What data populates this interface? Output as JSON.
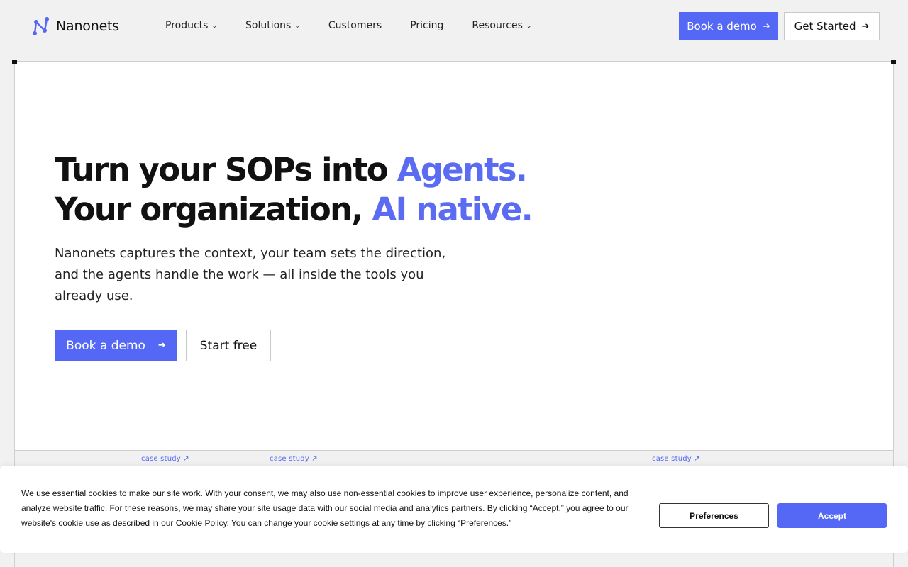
{
  "nav": {
    "logo_text": "Nanonets",
    "items": [
      {
        "label": "Products",
        "dropdown": true
      },
      {
        "label": "Solutions",
        "dropdown": true
      },
      {
        "label": "Customers",
        "dropdown": false
      },
      {
        "label": "Pricing",
        "dropdown": false
      },
      {
        "label": "Resources",
        "dropdown": true
      }
    ],
    "book_demo": "Book a demo",
    "get_started": "Get Started",
    "arrow": "➔",
    "chevron": "⌄"
  },
  "hero": {
    "line1_plain": "Turn your SOPs into ",
    "line1_accent": "Agents.",
    "line2_plain": "Your organization, ",
    "line2_accent": "AI native.",
    "subtitle": "Nanonets captures the context, your team sets the direction, and the agents handle the work — all inside the tools you already use.",
    "book_demo": "Book a demo",
    "start_free": "Start free",
    "arrow": "➔"
  },
  "case_studies": [
    "case study ↗",
    "case study ↗",
    "case study ↗"
  ],
  "cookie": {
    "text_1": "We use essential cookies to make our site work. With your consent, we may also use non-essential cookies to improve user experience, personalize content, and analyze website traffic. For these reasons, we may share your site usage data with our social media and analytics partners. By clicking “Accept,” you agree to our website's cookie use as described in our ",
    "policy_link": "Cookie Policy",
    "text_2": ". You can change your cookie settings at any time by clicking “",
    "pref_link": "Preferences",
    "text_3": ".”",
    "preferences_button": "Preferences",
    "accept_button": "Accept"
  },
  "colors": {
    "accent": "#5468f5",
    "accent_text": "#5b6cf2"
  }
}
